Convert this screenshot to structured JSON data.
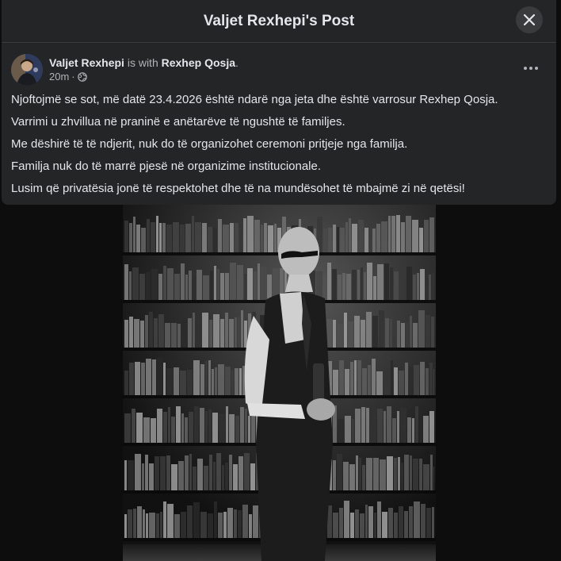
{
  "modal": {
    "title": "Valjet Rexhepi's Post",
    "close_icon": "close-icon"
  },
  "post": {
    "author": "Valjet Rexhepi",
    "with_text": "is with",
    "tagged": "Rexhep Qosja",
    "time": "20m",
    "audience_icon": "globe-icon",
    "paragraphs": [
      "Njoftojmë se sot, më datë 23.4.2026 është ndarë nga jeta dhe është varrosur Rexhep Qosja.",
      "Varrimi u zhvillua në praninë e anëtarëve të ngushtë të familjes.",
      "Me dëshirë të të ndjerit, nuk do të organizohet ceremoni pritjeje nga familja.",
      "Familja nuk do të marrë pjesë në organizime institucionale.",
      "Lusim që privatësia jonë të respektohet dhe të na mundësohet të mbajmë zi në qetësi!"
    ]
  },
  "colors": {
    "modal_bg": "#242526",
    "backdrop": "#0d0d0e",
    "text_primary": "#e4e6eb",
    "text_secondary": "#b0b3b8"
  }
}
